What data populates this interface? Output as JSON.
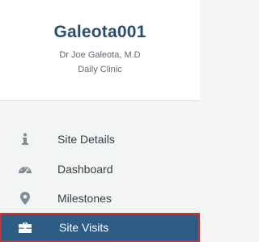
{
  "profile": {
    "site_id": "Galeota001",
    "doctor": "Dr Joe Galeota, M.D",
    "clinic": "Daily Clinic"
  },
  "nav": {
    "items": [
      {
        "label": "Site Details",
        "icon": "info-icon",
        "active": false
      },
      {
        "label": "Dashboard",
        "icon": "dashboard-icon",
        "active": false
      },
      {
        "label": "Milestones",
        "icon": "map-marker-icon",
        "active": false
      },
      {
        "label": "Site Visits",
        "icon": "briefcase-icon",
        "active": true
      }
    ]
  },
  "colors": {
    "title": "#2d4e6b",
    "active_bg": "#2d5c84",
    "active_border": "#d32f2f"
  }
}
